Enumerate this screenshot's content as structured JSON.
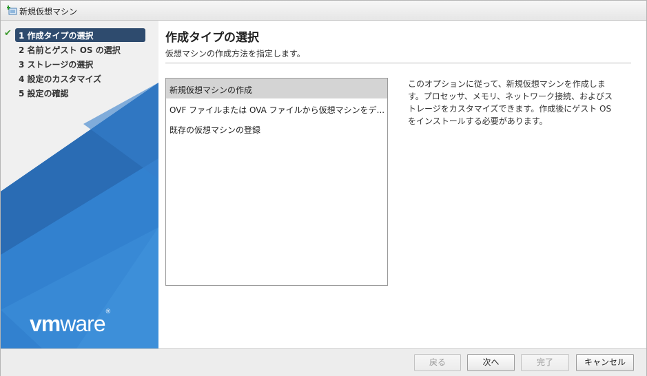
{
  "window": {
    "title": "新規仮想マシン",
    "icon": "new-vm-icon"
  },
  "sidebar": {
    "steps": [
      {
        "label": "1 作成タイプの選択",
        "active": true,
        "done": true
      },
      {
        "label": "2 名前とゲスト OS の選択",
        "active": false,
        "done": false
      },
      {
        "label": "3 ストレージの選択",
        "active": false,
        "done": false
      },
      {
        "label": "4 設定のカスタマイズ",
        "active": false,
        "done": false
      },
      {
        "label": "5 設定の確認",
        "active": false,
        "done": false
      }
    ],
    "check_mark": "✔",
    "logo": {
      "bold": "vm",
      "normal": "ware",
      "mark": "®"
    }
  },
  "main": {
    "title": "作成タイプの選択",
    "subtitle": "仮想マシンの作成方法を指定します。",
    "options": [
      "新規仮想マシンの作成",
      "OVF ファイルまたは OVA ファイルから仮想マシンをデ...",
      "既存の仮想マシンの登録"
    ],
    "selected_index": 0,
    "description": "このオプションに従って、新規仮想マシンを作成します。プロセッサ、メモリ、ネットワーク接続、およびストレージをカスタマイズできます。作成後にゲスト OS をインストールする必要があります。"
  },
  "footer": {
    "back_label": "戻る",
    "next_label": "次へ",
    "finish_label": "完了",
    "cancel_label": "キャンセル"
  },
  "colors": {
    "active_step_bg": "#2e4b6e",
    "check_green": "#3d9a2e",
    "sidebar_blue": "#2f78c5"
  }
}
